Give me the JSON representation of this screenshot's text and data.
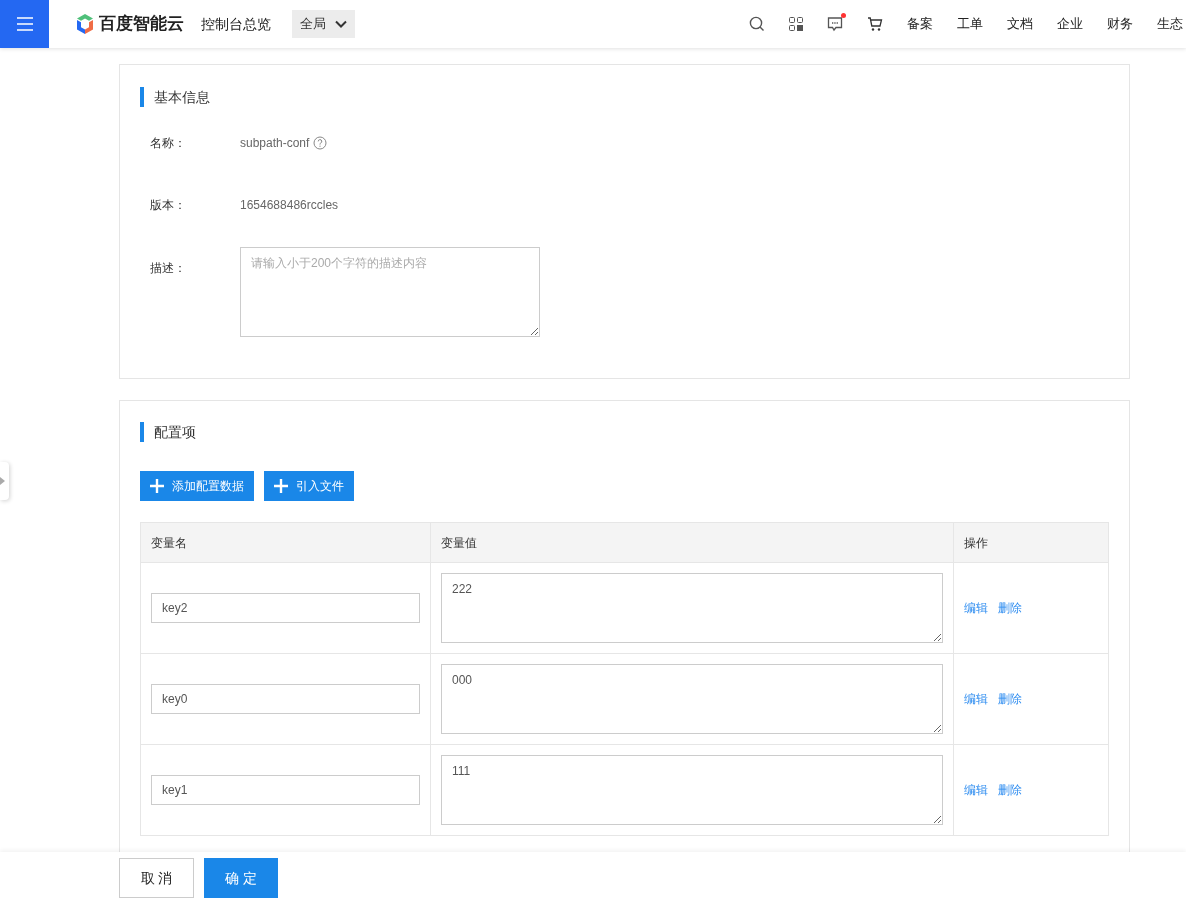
{
  "header": {
    "brand": "百度智能云",
    "console": "控制台总览",
    "region": "全局",
    "nav": [
      {
        "label": "备案"
      },
      {
        "label": "工单"
      },
      {
        "label": "文档"
      },
      {
        "label": "企业"
      },
      {
        "label": "财务"
      },
      {
        "label": "生态"
      }
    ],
    "messages_unread": true
  },
  "basic": {
    "title": "基本信息",
    "name_label": "名称：",
    "name_value": "subpath-conf",
    "version_label": "版本：",
    "version_value": "1654688486rccles",
    "desc_label": "描述：",
    "desc_placeholder": "请输入小于200个字符的描述内容"
  },
  "config": {
    "title": "配置项",
    "buttons": [
      {
        "label": "添加配置数据"
      },
      {
        "label": "引入文件"
      }
    ],
    "columns": [
      "变量名",
      "变量值",
      "操作"
    ],
    "rows": [
      {
        "key": "key2",
        "value": "222",
        "actions": [
          "编辑",
          "删除"
        ]
      },
      {
        "key": "key0",
        "value": "000",
        "actions": [
          "编辑",
          "删除"
        ]
      },
      {
        "key": "key1",
        "value": "111",
        "actions": [
          "编辑",
          "删除"
        ]
      }
    ]
  },
  "footer": {
    "cancel": "取 消",
    "confirm": "确 定"
  }
}
